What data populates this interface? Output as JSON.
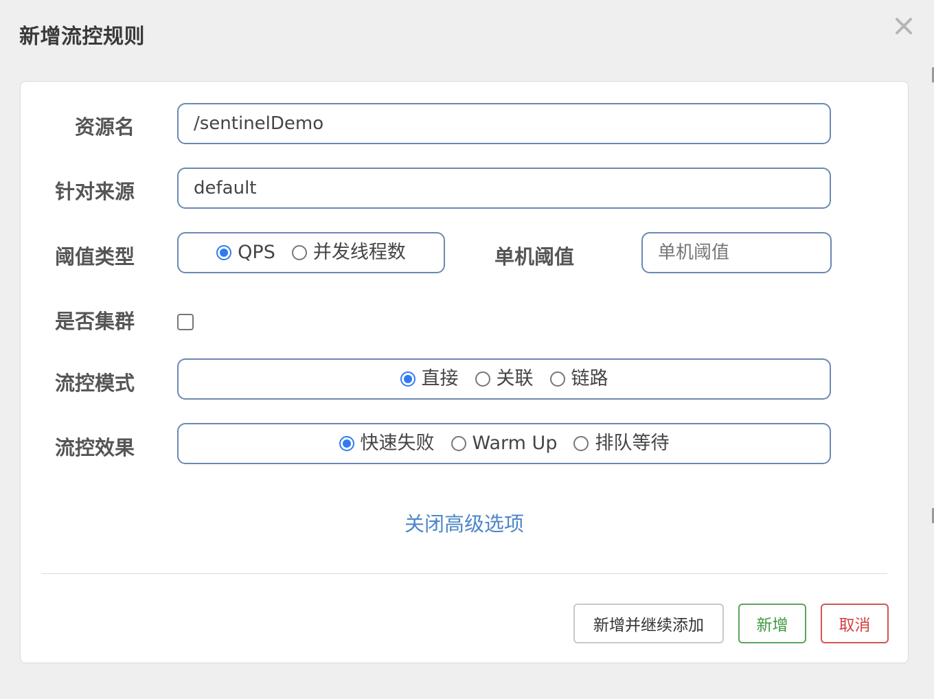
{
  "dialog": {
    "title": "新增流控规则",
    "close_icon": "close-icon"
  },
  "form": {
    "resource_name": {
      "label": "资源名",
      "value": "/sentinelDemo"
    },
    "limit_app": {
      "label": "针对来源",
      "value": "default"
    },
    "threshold_type": {
      "label": "阈值类型",
      "options": [
        {
          "label": "QPS",
          "selected": true
        },
        {
          "label": "并发线程数",
          "selected": false
        }
      ]
    },
    "single_threshold": {
      "label": "单机阈值",
      "placeholder": "单机阈值",
      "value": ""
    },
    "cluster": {
      "label": "是否集群",
      "checked": false
    },
    "strategy": {
      "label": "流控模式",
      "options": [
        {
          "label": "直接",
          "selected": true
        },
        {
          "label": "关联",
          "selected": false
        },
        {
          "label": "链路",
          "selected": false
        }
      ]
    },
    "control_behavior": {
      "label": "流控效果",
      "options": [
        {
          "label": "快速失败",
          "selected": true
        },
        {
          "label": "Warm Up",
          "selected": false
        },
        {
          "label": "排队等待",
          "selected": false
        }
      ]
    },
    "advanced_link": "关闭高级选项"
  },
  "footer": {
    "add_continue_label": "新增并继续添加",
    "add_label": "新增",
    "cancel_label": "取消"
  },
  "colors": {
    "accent": "#2f7bf0",
    "input_border": "#6b87b3",
    "link": "#4d86c8",
    "success": "#3e9a3e",
    "danger": "#d43f3f"
  }
}
